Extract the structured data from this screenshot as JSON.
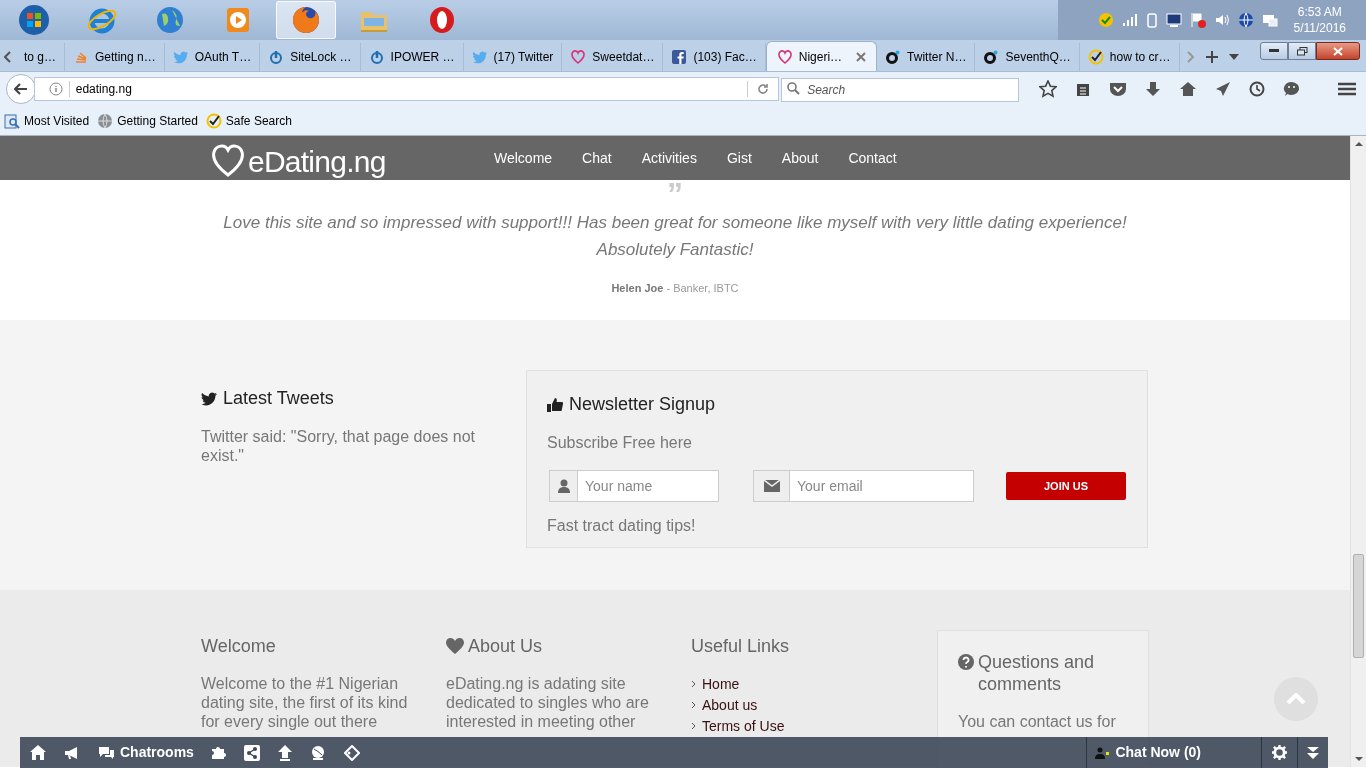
{
  "taskbar": {
    "apps": [
      {
        "selected": false
      },
      {
        "selected": false
      },
      {
        "selected": false
      },
      {
        "selected": false
      },
      {
        "selected": true
      },
      {
        "selected": false
      },
      {
        "selected": false
      }
    ],
    "time": "6:53 AM",
    "date": "5/11/2016"
  },
  "browser": {
    "tabs": [
      {
        "title": "to g…",
        "kind": "none",
        "selected": false
      },
      {
        "title": "Getting n…",
        "kind": "stack",
        "selected": false
      },
      {
        "title": "OAuth T…",
        "kind": "bird",
        "selected": false
      },
      {
        "title": "SiteLock …",
        "kind": "power",
        "selected": false
      },
      {
        "title": "IPOWER …",
        "kind": "power",
        "selected": false
      },
      {
        "title": "(17) Twitter",
        "kind": "bird",
        "selected": false
      },
      {
        "title": "Sweetdat…",
        "kind": "heart",
        "selected": false
      },
      {
        "title": "(103) Fac…",
        "kind": "fb",
        "selected": false
      },
      {
        "title": "Nigeri…",
        "kind": "heart",
        "selected": true
      },
      {
        "title": "Twitter N…",
        "kind": "ring",
        "selected": false
      },
      {
        "title": "SeventhQ…",
        "kind": "ring",
        "selected": false
      },
      {
        "title": "how to cr…",
        "kind": "check",
        "selected": false
      }
    ],
    "url": "edating.ng",
    "search_placeholder": "Search",
    "bookmarks": [
      {
        "label": "Most Visited",
        "kind": "folder"
      },
      {
        "label": "Getting Started",
        "kind": "globe"
      },
      {
        "label": "Safe Search",
        "kind": "check"
      }
    ]
  },
  "site": {
    "logo": "eDating.ng",
    "nav": [
      "Welcome",
      "Chat",
      "Activities",
      "Gist",
      "About",
      "Contact"
    ],
    "testimonial": {
      "quote_mark": "”",
      "quote": "Love this site and so impressed with support!!! Has been great for someone like myself with very little dating experience! Absolutely Fantastic!",
      "author": "**Helen Joe** - Banker, IBTC"
    },
    "tweets": {
      "title": "Latest Tweets",
      "text": "Twitter said: \"Sorry, that page does not exist.\""
    },
    "newsletter": {
      "title": "Newsletter Signup",
      "subtitle": "Subscribe Free here",
      "name_placeholder": "Your name",
      "email_placeholder": "Your email",
      "button": "JOIN US",
      "note": "Fast tract dating tips!"
    },
    "footer": {
      "welcome": {
        "title": "Welcome",
        "text": "Welcome to the #1 Nigerian dating site, the first of its kind for every single out there"
      },
      "about": {
        "title": "About Us",
        "text": "eDating.ng is adating site dedicated to singles who are interested in meeting other"
      },
      "links": {
        "title": "Useful Links",
        "items": [
          "Home",
          "About us",
          "Terms of Use"
        ]
      },
      "questions": {
        "title": "Questions and comments",
        "text": "You can contact us for"
      }
    },
    "chat_bar": {
      "rooms": "Chatrooms",
      "chat_now": "Chat Now (0)"
    }
  }
}
